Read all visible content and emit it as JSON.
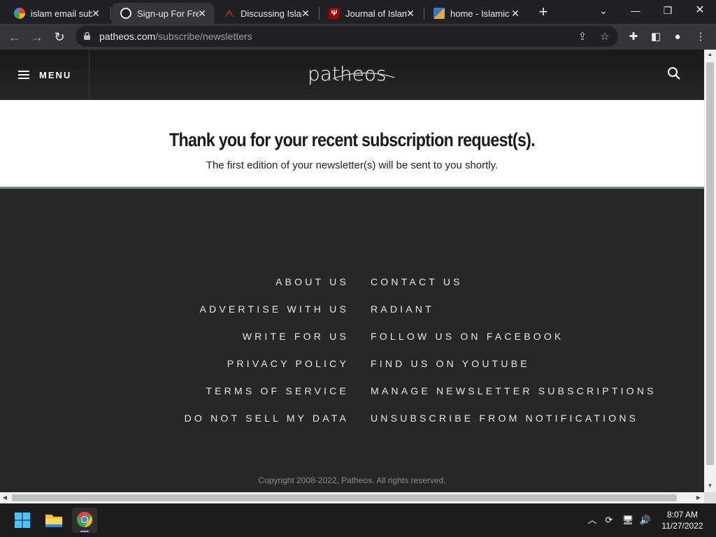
{
  "browser": {
    "tabs": [
      {
        "title": "islam email subs",
        "active": false
      },
      {
        "title": "Sign-up For Free",
        "active": true
      },
      {
        "title": "Discussing Islam",
        "active": false
      },
      {
        "title": "Journal of Islamic",
        "active": false
      },
      {
        "title": "home - Islamic",
        "active": false
      }
    ],
    "url_host": "patheos.com",
    "url_path": "/subscribe/newsletters"
  },
  "site": {
    "menu_label": "MENU",
    "logo_text": "patheos",
    "thanks_title": "Thank you for your recent subscription request(s).",
    "thanks_sub": "The first edition of your newsletter(s) will be sent to you shortly.",
    "footer_left": [
      "ABOUT US",
      "ADVERTISE WITH US",
      "WRITE FOR US",
      "PRIVACY POLICY",
      "TERMS OF SERVICE",
      "DO NOT SELL MY DATA"
    ],
    "footer_right": [
      "CONTACT US",
      "RADIANT",
      "FOLLOW US ON FACEBOOK",
      "FIND US ON YOUTUBE",
      "MANAGE NEWSLETTER SUBSCRIPTIONS",
      "UNSUBSCRIBE FROM NOTIFICATIONS"
    ],
    "copyright": "Copyright 2008-2022, Patheos. All rights reserved."
  },
  "taskbar": {
    "time": "8:07 AM",
    "date": "11/27/2022"
  },
  "colors": {
    "accent_line": "#6a8c86",
    "header_bg": "#1a1a1a",
    "footer_bg": "#272727"
  }
}
